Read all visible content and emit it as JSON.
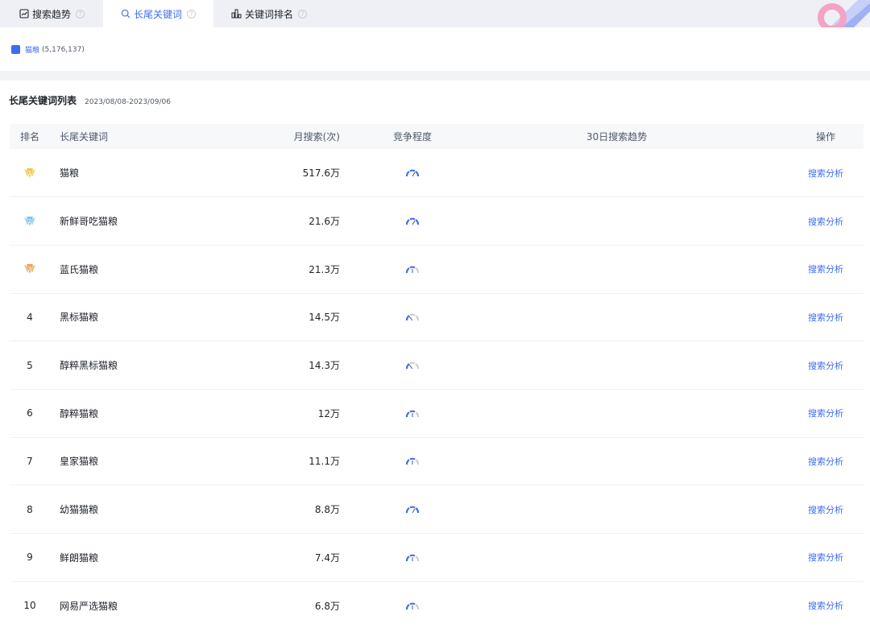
{
  "tabs": [
    {
      "label": "搜索趋势",
      "icon": "line-chart-icon"
    },
    {
      "label": "长尾关键词",
      "icon": "search-icon"
    },
    {
      "label": "关键词排名",
      "icon": "bar-chart-icon"
    }
  ],
  "filter": {
    "legend_name": "猫粮",
    "legend_count": "(5,176,137)"
  },
  "card": {
    "title": "长尾关键词列表",
    "date_range": "2023/08/08-2023/09/06"
  },
  "table": {
    "headers": {
      "rank": "排名",
      "keyword": "长尾关键词",
      "volume": "月搜索(次)",
      "competition": "竞争程度",
      "trend": "30日搜索趋势",
      "action": "操作"
    },
    "rows": [
      {
        "rank": "1",
        "keyword": "猫粮",
        "volume": "517.6万",
        "competition": "high",
        "action": "搜索分析"
      },
      {
        "rank": "2",
        "keyword": "新鲜哥吃猫粮",
        "volume": "21.6万",
        "competition": "high",
        "action": "搜索分析"
      },
      {
        "rank": "3",
        "keyword": "蓝氏猫粮",
        "volume": "21.3万",
        "competition": "medium",
        "action": "搜索分析"
      },
      {
        "rank": "4",
        "keyword": "黑标猫粮",
        "volume": "14.5万",
        "competition": "low",
        "action": "搜索分析"
      },
      {
        "rank": "5",
        "keyword": "醇粹黑标猫粮",
        "volume": "14.3万",
        "competition": "low",
        "action": "搜索分析"
      },
      {
        "rank": "6",
        "keyword": "醇粹猫粮",
        "volume": "12万",
        "competition": "medium",
        "action": "搜索分析"
      },
      {
        "rank": "7",
        "keyword": "皇家猫粮",
        "volume": "11.1万",
        "competition": "medium",
        "action": "搜索分析"
      },
      {
        "rank": "8",
        "keyword": "幼猫猫粮",
        "volume": "8.8万",
        "competition": "high",
        "action": "搜索分析"
      },
      {
        "rank": "9",
        "keyword": "鲜朗猫粮",
        "volume": "7.4万",
        "competition": "medium",
        "action": "搜索分析"
      },
      {
        "rank": "10",
        "keyword": "网易严选猫粮",
        "volume": "6.8万",
        "competition": "medium",
        "action": "搜索分析"
      }
    ]
  },
  "colors": {
    "accent": "#3f6cf1",
    "gold": "#f2c94c",
    "silver": "#7fc6f0",
    "bronze": "#e9a55a"
  }
}
